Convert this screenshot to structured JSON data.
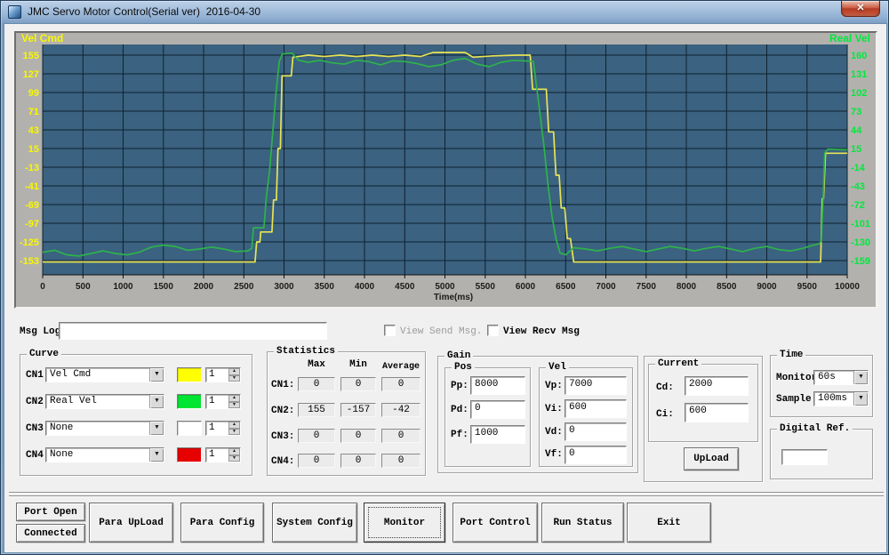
{
  "window": {
    "title": "JMC Servo Motor Control(Serial ver)  2016-04-30"
  },
  "chart_data": {
    "type": "line",
    "xlabel": "Time(ms)",
    "xlim": [
      0,
      10000
    ],
    "grid": true,
    "plot_bg": "#3b6280",
    "x_ticks": [
      0,
      500,
      1000,
      1500,
      2000,
      2500,
      3000,
      3500,
      4000,
      4500,
      5000,
      5500,
      6000,
      6500,
      7000,
      7500,
      8000,
      8500,
      9000,
      9500,
      10000
    ],
    "left_axis": {
      "label": "Vel Cmd",
      "color": "#f8f800",
      "ticks": [
        155,
        127,
        99,
        71,
        43,
        15,
        -13,
        -41,
        -69,
        -97,
        -125,
        -153
      ]
    },
    "right_axis": {
      "label": "Real Vel",
      "color": "#00e93c",
      "ticks": [
        160,
        131,
        102,
        73,
        44,
        15,
        -14,
        -43,
        -72,
        -101,
        -130,
        -159
      ]
    },
    "series": [
      {
        "name": "Vel Cmd",
        "axis": "left",
        "color": "#e8e455",
        "points": [
          [
            0,
            -155
          ],
          [
            2640,
            -155
          ],
          [
            2660,
            -125
          ],
          [
            2700,
            -125
          ],
          [
            2710,
            -110
          ],
          [
            2850,
            -110
          ],
          [
            2870,
            -62
          ],
          [
            2905,
            -62
          ],
          [
            2925,
            15
          ],
          [
            2955,
            15
          ],
          [
            2975,
            124
          ],
          [
            3090,
            124
          ],
          [
            3110,
            152
          ],
          [
            3300,
            155
          ],
          [
            3500,
            153
          ],
          [
            3700,
            155
          ],
          [
            3900,
            153
          ],
          [
            4100,
            155
          ],
          [
            4300,
            153
          ],
          [
            4500,
            155
          ],
          [
            4700,
            153
          ],
          [
            4850,
            159
          ],
          [
            5250,
            159
          ],
          [
            5350,
            152
          ],
          [
            5600,
            154
          ],
          [
            5900,
            155
          ],
          [
            6060,
            155
          ],
          [
            6090,
            104
          ],
          [
            6260,
            104
          ],
          [
            6290,
            40
          ],
          [
            6350,
            40
          ],
          [
            6380,
            -25
          ],
          [
            6420,
            -25
          ],
          [
            6445,
            -74
          ],
          [
            6490,
            -74
          ],
          [
            6520,
            -120
          ],
          [
            6560,
            -120
          ],
          [
            6600,
            -155
          ],
          [
            9670,
            -155
          ],
          [
            9690,
            -60
          ],
          [
            9705,
            -60
          ],
          [
            9730,
            8
          ],
          [
            10000,
            8
          ]
        ]
      },
      {
        "name": "Real Vel",
        "axis": "right",
        "color": "#2db34a",
        "points": [
          [
            0,
            -146
          ],
          [
            150,
            -143
          ],
          [
            300,
            -150
          ],
          [
            450,
            -152
          ],
          [
            600,
            -148
          ],
          [
            750,
            -144
          ],
          [
            900,
            -148
          ],
          [
            1050,
            -150
          ],
          [
            1200,
            -146
          ],
          [
            1350,
            -138
          ],
          [
            1500,
            -135
          ],
          [
            1650,
            -137
          ],
          [
            1800,
            -143
          ],
          [
            1950,
            -141
          ],
          [
            2100,
            -138
          ],
          [
            2250,
            -141
          ],
          [
            2400,
            -145
          ],
          [
            2550,
            -144
          ],
          [
            2600,
            -140
          ],
          [
            2620,
            -108
          ],
          [
            2750,
            -108
          ],
          [
            2780,
            -60
          ],
          [
            2820,
            -20
          ],
          [
            2860,
            40
          ],
          [
            2900,
            100
          ],
          [
            2940,
            150
          ],
          [
            2980,
            162
          ],
          [
            3100,
            163
          ],
          [
            3180,
            152
          ],
          [
            3300,
            149
          ],
          [
            3450,
            152
          ],
          [
            3600,
            148
          ],
          [
            3750,
            146
          ],
          [
            3900,
            152
          ],
          [
            4050,
            150
          ],
          [
            4200,
            145
          ],
          [
            4350,
            151
          ],
          [
            4500,
            150
          ],
          [
            4650,
            147
          ],
          [
            4800,
            142
          ],
          [
            4950,
            145
          ],
          [
            5100,
            152
          ],
          [
            5250,
            155
          ],
          [
            5400,
            146
          ],
          [
            5550,
            142
          ],
          [
            5700,
            149
          ],
          [
            5850,
            152
          ],
          [
            6000,
            151
          ],
          [
            6100,
            150
          ],
          [
            6140,
            110
          ],
          [
            6180,
            70
          ],
          [
            6230,
            20
          ],
          [
            6280,
            -40
          ],
          [
            6330,
            -90
          ],
          [
            6380,
            -125
          ],
          [
            6430,
            -147
          ],
          [
            6500,
            -150
          ],
          [
            6600,
            -139
          ],
          [
            6750,
            -141
          ],
          [
            6900,
            -144
          ],
          [
            7050,
            -140
          ],
          [
            7200,
            -137
          ],
          [
            7350,
            -141
          ],
          [
            7500,
            -145
          ],
          [
            7650,
            -141
          ],
          [
            7800,
            -137
          ],
          [
            7950,
            -140
          ],
          [
            8100,
            -144
          ],
          [
            8250,
            -140
          ],
          [
            8400,
            -137
          ],
          [
            8550,
            -141
          ],
          [
            8700,
            -145
          ],
          [
            8850,
            -140
          ],
          [
            9000,
            -137
          ],
          [
            9150,
            -142
          ],
          [
            9300,
            -144
          ],
          [
            9450,
            -140
          ],
          [
            9550,
            -136
          ],
          [
            9650,
            -133
          ],
          [
            9680,
            -128
          ],
          [
            9700,
            -60
          ],
          [
            9720,
            8
          ],
          [
            9760,
            14
          ],
          [
            10000,
            13
          ]
        ]
      }
    ]
  },
  "msg_log": {
    "label": "Msg Log:",
    "value": "",
    "send_chk": "View Send Msg.",
    "recv_chk": "View Recv Msg"
  },
  "curve": {
    "title": "Curve",
    "rows": [
      {
        "label": "CN1:",
        "value": "Vel Cmd",
        "color": "#ffff00",
        "scale": "1"
      },
      {
        "label": "CN2:",
        "value": "Real Vel",
        "color": "#00e432",
        "scale": "1"
      },
      {
        "label": "CN3:",
        "value": "None",
        "color": "#ffffff",
        "scale": "1"
      },
      {
        "label": "CN4:",
        "value": "None",
        "color": "#e60000",
        "scale": "1"
      }
    ]
  },
  "statistics": {
    "title": "Statistics",
    "headers": [
      "Max",
      "Min",
      "Average"
    ],
    "rows": [
      {
        "label": "CN1:",
        "max": "0",
        "min": "0",
        "avg": "0"
      },
      {
        "label": "CN2:",
        "max": "155",
        "min": "-157",
        "avg": "-42"
      },
      {
        "label": "CN3:",
        "max": "0",
        "min": "0",
        "avg": "0"
      },
      {
        "label": "CN4:",
        "max": "0",
        "min": "0",
        "avg": "0"
      }
    ]
  },
  "gain": {
    "title": "Gain",
    "pos": {
      "title": "Pos",
      "fields": [
        {
          "label": "Pp:",
          "value": "8000"
        },
        {
          "label": "Pd:",
          "value": "0"
        },
        {
          "label": "Pf:",
          "value": "1000"
        }
      ]
    },
    "vel": {
      "title": "Vel",
      "fields": [
        {
          "label": "Vp:",
          "value": "7000"
        },
        {
          "label": "Vi:",
          "value": "600"
        },
        {
          "label": "Vd:",
          "value": "0"
        },
        {
          "label": "Vf:",
          "value": "0"
        }
      ]
    }
  },
  "current": {
    "title": "Current",
    "fields": [
      {
        "label": "Cd:",
        "value": "2000"
      },
      {
        "label": "Ci:",
        "value": "600"
      }
    ],
    "upload": "UpLoad"
  },
  "time": {
    "title": "Time",
    "monitor_label": "Monitor:",
    "monitor_value": "60s",
    "sample_label": "Sample:",
    "sample_value": "100ms"
  },
  "digital_ref": {
    "title": "Digital Ref.",
    "value": ""
  },
  "footer": {
    "port_open": "Port Open",
    "connected": "Connected",
    "buttons": [
      "Para UpLoad",
      "Para Config",
      "System Config",
      "Monitor",
      "Port Control",
      "Run Status",
      "Exit"
    ]
  }
}
